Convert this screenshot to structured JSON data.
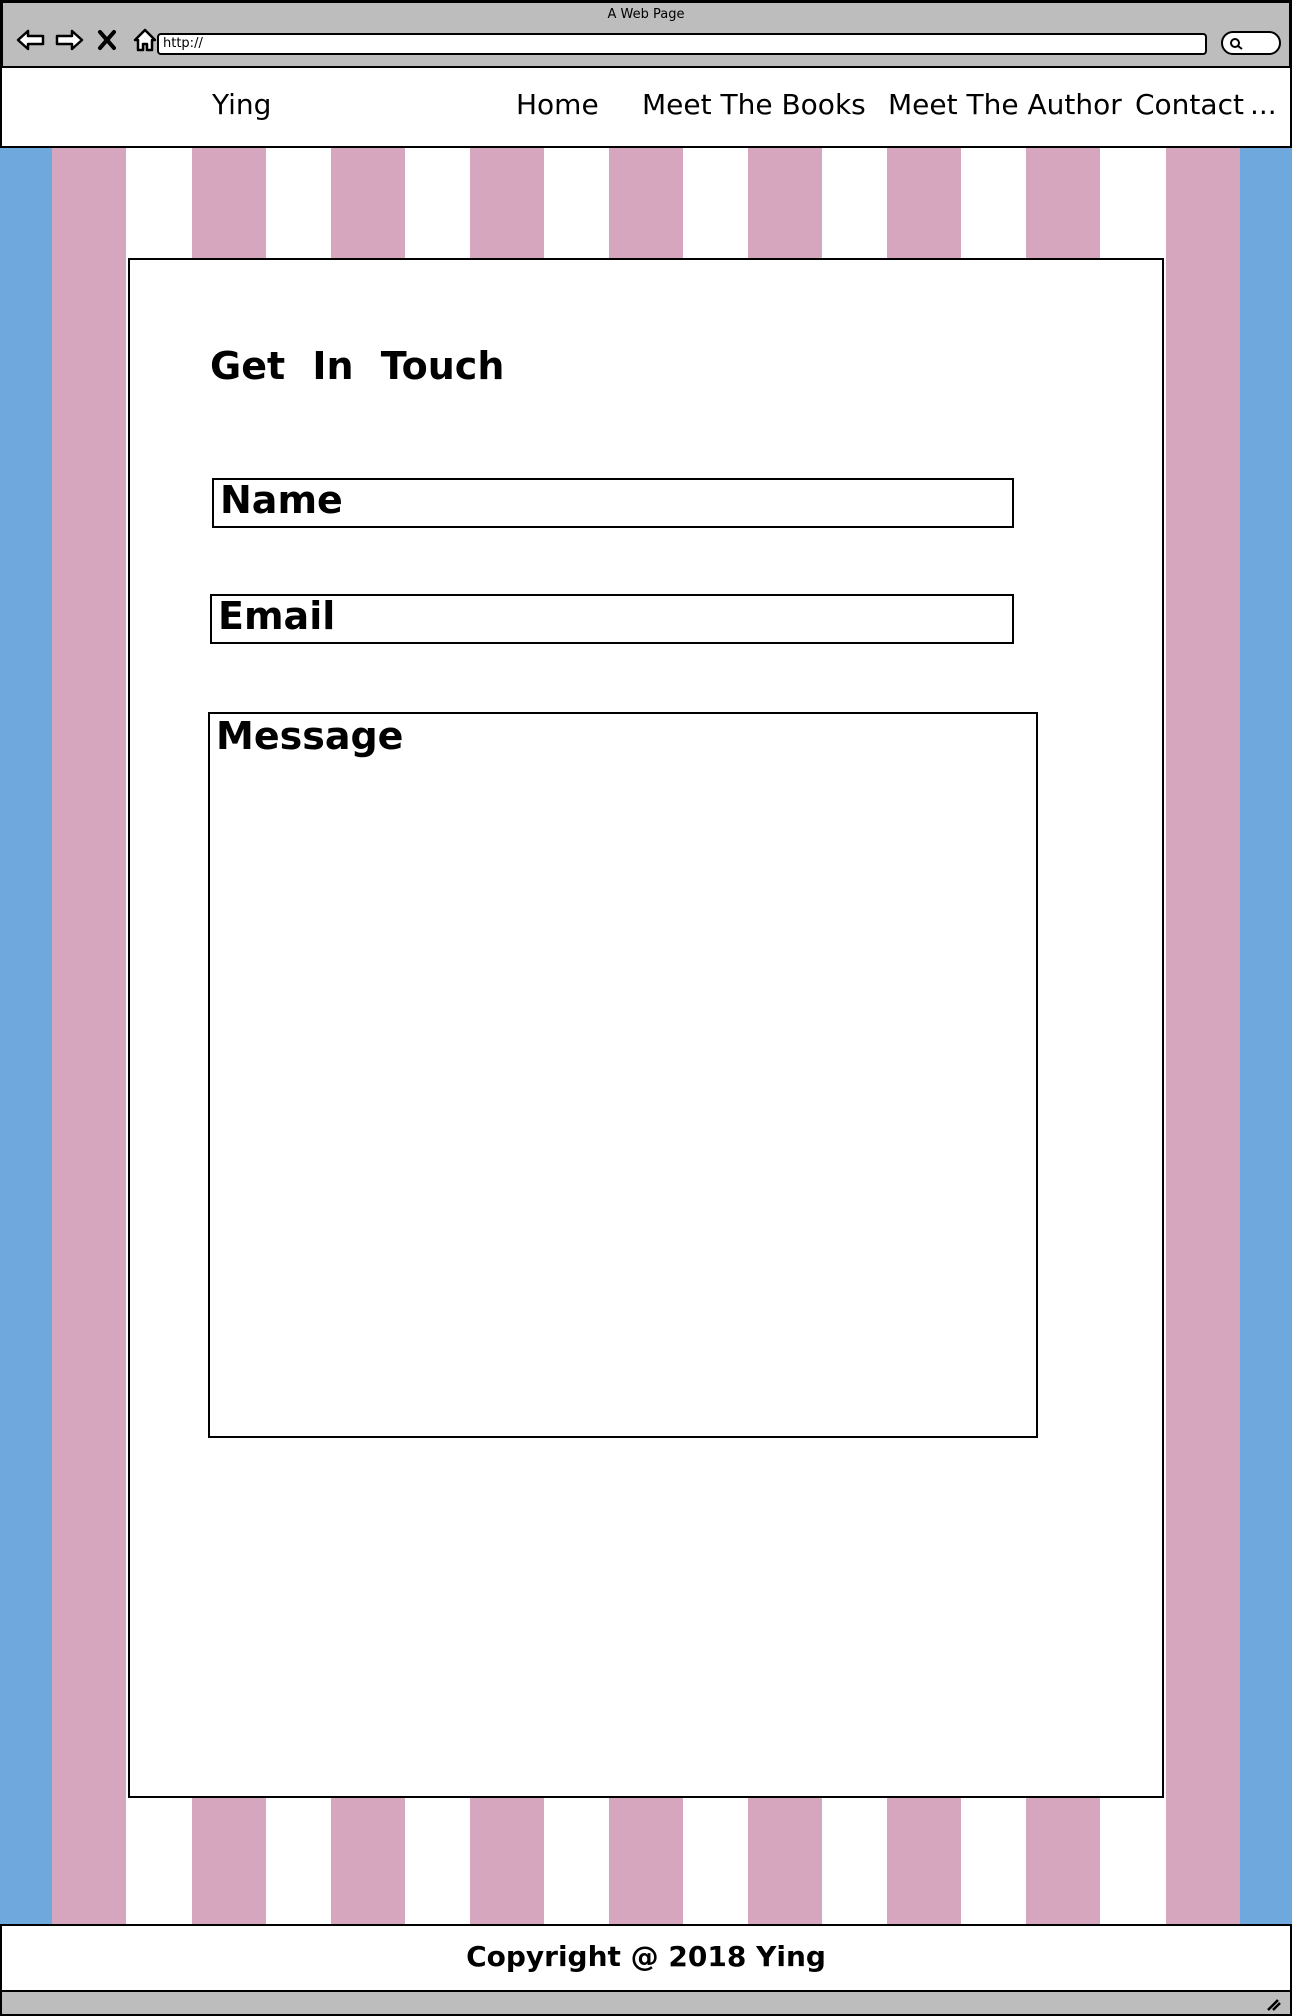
{
  "browser": {
    "window_title": "A Web Page",
    "url": "http://",
    "icons": [
      "back-arrow-icon",
      "forward-arrow-icon",
      "close-icon",
      "home-icon",
      "search-icon"
    ]
  },
  "header": {
    "logo": "Ying",
    "nav": {
      "home": "Home",
      "books": "Meet The Books",
      "author": "Meet The Author",
      "contact": "Contact",
      "more": "..."
    }
  },
  "contact_form": {
    "heading": "Get In Touch",
    "name_label": "Name",
    "email_label": "Email",
    "message_label": "Message"
  },
  "footer": {
    "copyright": "Copyright @ 2018 Ying"
  },
  "colors": {
    "chrome": "#bdbdbd",
    "blue": "#6fa8dc",
    "pink": "#d5a6bd",
    "white": "#ffffff"
  }
}
